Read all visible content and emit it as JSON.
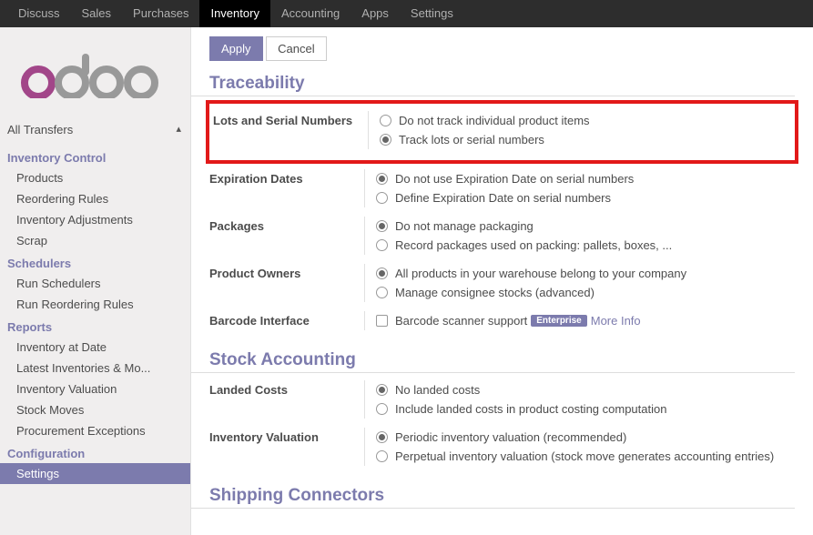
{
  "topbar": {
    "items": [
      "Discuss",
      "Sales",
      "Purchases",
      "Inventory",
      "Accounting",
      "Apps",
      "Settings"
    ],
    "active": "Inventory"
  },
  "sidebar": {
    "all_transfers": "All Transfers",
    "sections": [
      {
        "heading": "Inventory Control",
        "items": [
          "Products",
          "Reordering Rules",
          "Inventory Adjustments",
          "Scrap"
        ]
      },
      {
        "heading": "Schedulers",
        "items": [
          "Run Schedulers",
          "Run Reordering Rules"
        ]
      },
      {
        "heading": "Reports",
        "items": [
          "Inventory at Date",
          "Latest Inventories & Mo...",
          "Inventory Valuation",
          "Stock Moves",
          "Procurement Exceptions"
        ]
      },
      {
        "heading": "Configuration",
        "items": [
          "Settings"
        ]
      }
    ],
    "active_item": "Settings"
  },
  "buttons": {
    "apply": "Apply",
    "cancel": "Cancel"
  },
  "sections": {
    "traceability": {
      "title": "Traceability",
      "lots": {
        "label": "Lots and Serial Numbers",
        "opt1": "Do not track individual product items",
        "opt2": "Track lots or serial numbers",
        "selected": 1
      },
      "expiration": {
        "label": "Expiration Dates",
        "opt1": "Do not use Expiration Date on serial numbers",
        "opt2": "Define Expiration Date on serial numbers",
        "selected": 0
      },
      "packages": {
        "label": "Packages",
        "opt1": "Do not manage packaging",
        "opt2": "Record packages used on packing: pallets, boxes, ...",
        "selected": 0
      },
      "owners": {
        "label": "Product Owners",
        "opt1": "All products in your warehouse belong to your company",
        "opt2": "Manage consignee stocks (advanced)",
        "selected": 0
      },
      "barcode": {
        "label": "Barcode Interface",
        "opt1": "Barcode scanner support",
        "badge": "Enterprise",
        "link": "More Info"
      }
    },
    "stock_accounting": {
      "title": "Stock Accounting",
      "landed": {
        "label": "Landed Costs",
        "opt1": "No landed costs",
        "opt2": "Include landed costs in product costing computation",
        "selected": 0
      },
      "valuation": {
        "label": "Inventory Valuation",
        "opt1": "Periodic inventory valuation (recommended)",
        "opt2": "Perpetual inventory valuation (stock move generates accounting entries)",
        "selected": 0
      }
    },
    "shipping": {
      "title": "Shipping Connectors"
    }
  }
}
